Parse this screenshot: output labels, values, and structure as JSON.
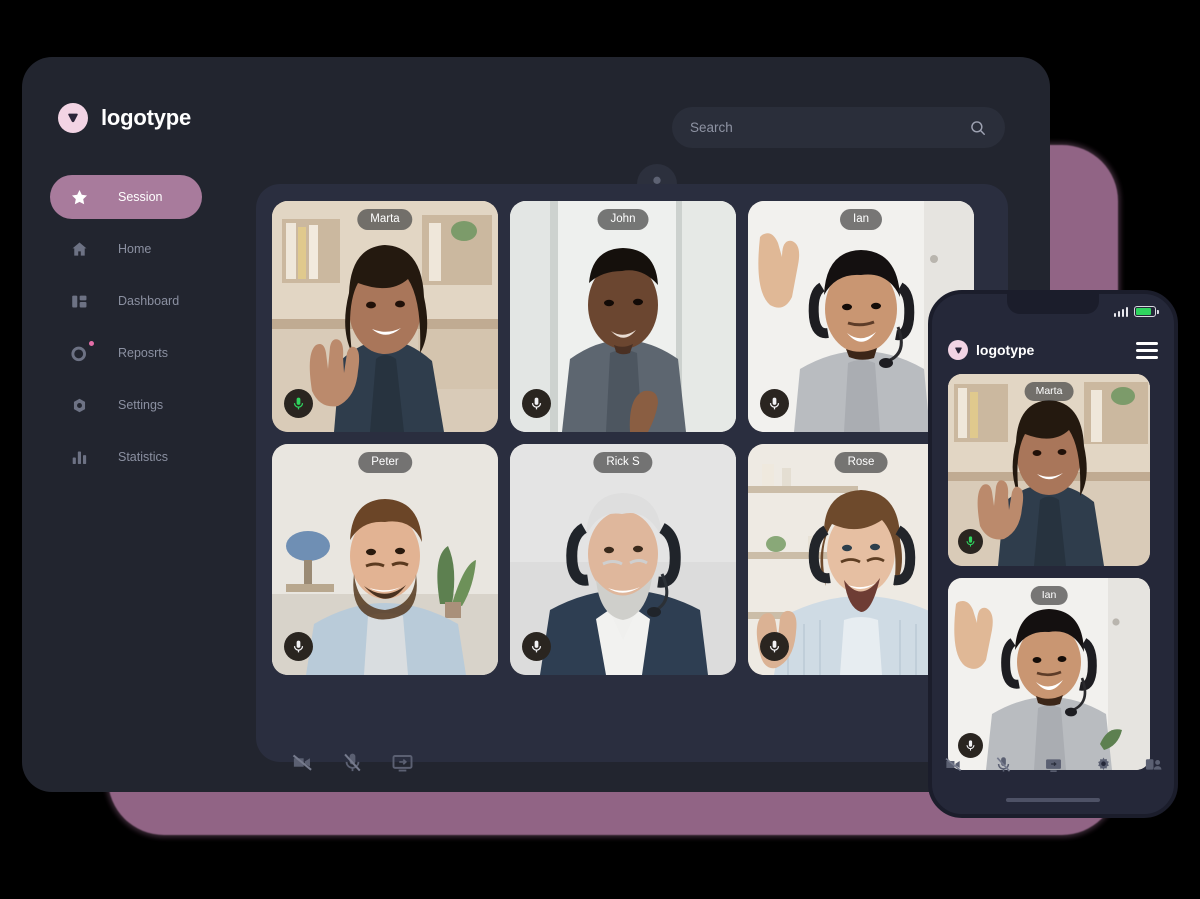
{
  "brand": {
    "name": "logotype",
    "logo_icon": "triangle-logo-icon",
    "accent": "#f2d4e4"
  },
  "header": {
    "avatar_icon": "user-avatar-icon",
    "search": {
      "placeholder": "Search",
      "value": "",
      "icon": "search-icon"
    }
  },
  "sidebar": {
    "items": [
      {
        "label": "Session",
        "icon": "star-icon",
        "active": true,
        "badge": false
      },
      {
        "label": "Home",
        "icon": "home-icon",
        "active": false,
        "badge": false
      },
      {
        "label": "Dashboard",
        "icon": "dashboard-icon",
        "active": false,
        "badge": false
      },
      {
        "label": "Reposrts",
        "icon": "reports-icon",
        "active": false,
        "badge": true
      },
      {
        "label": "Settings",
        "icon": "settings-icon",
        "active": false,
        "badge": false
      },
      {
        "label": "Statistics",
        "icon": "statistics-icon",
        "active": false,
        "badge": false
      }
    ],
    "active_color": "#a87b9c",
    "badge_color": "#e56ea8"
  },
  "call": {
    "participants": [
      {
        "name": "Marta",
        "mic": "active"
      },
      {
        "name": "John",
        "mic": "muted"
      },
      {
        "name": "Ian",
        "mic": "muted"
      },
      {
        "name": "Peter",
        "mic": "muted"
      },
      {
        "name": "Rick S",
        "mic": "muted"
      },
      {
        "name": "Rose",
        "mic": "muted"
      }
    ],
    "controls": [
      {
        "icon": "camera-off-icon",
        "label": "Camera"
      },
      {
        "icon": "mic-muted-icon",
        "label": "Microphone"
      },
      {
        "icon": "screen-share-icon",
        "label": "Share screen"
      }
    ]
  },
  "phone": {
    "status": {
      "signal_icon": "signal-bars-icon",
      "battery_icon": "battery-icon",
      "battery_color": "#2fd45e"
    },
    "menu_icon": "hamburger-menu-icon",
    "participants": [
      {
        "name": "Marta",
        "mic": "active"
      },
      {
        "name": "Ian",
        "mic": "muted"
      }
    ],
    "controls": [
      {
        "icon": "camera-off-icon",
        "label": "Camera"
      },
      {
        "icon": "mic-muted-icon",
        "label": "Microphone"
      },
      {
        "icon": "screen-share-icon",
        "label": "Share screen"
      },
      {
        "icon": "gear-icon",
        "label": "Settings"
      },
      {
        "icon": "participants-icon",
        "label": "Participants"
      }
    ]
  },
  "theme": {
    "page_background": "#000000",
    "window_background": "#22252f",
    "panel_background": "#2a2e3f",
    "accent_purple": "#96688a"
  }
}
